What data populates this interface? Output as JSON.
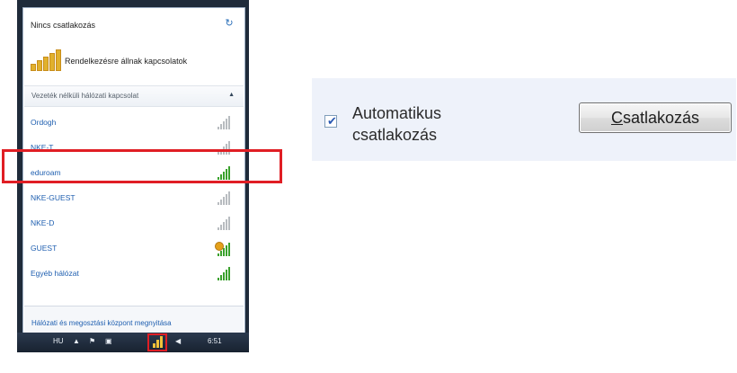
{
  "flyout": {
    "status_title": "Nincs csatlakozás",
    "available_label": "Rendelkezésre állnak kapcsolatok",
    "section_label": "Vezeték nélküli hálózati kapcsolat",
    "networks": [
      {
        "name": "Ordogh",
        "signal": "weak"
      },
      {
        "name": "NKE-T",
        "signal": "weak"
      },
      {
        "name": "eduroam",
        "signal": "strong"
      },
      {
        "name": "NKE-GUEST",
        "signal": "weak"
      },
      {
        "name": "NKE-D",
        "signal": "weak"
      },
      {
        "name": "GUEST",
        "signal": "strong-unsecured"
      },
      {
        "name": "Egyéb hálózat",
        "signal": "strong"
      }
    ],
    "footer_link": "Hálózati és megosztási központ megnyitása"
  },
  "taskbar": {
    "language": "HU",
    "time": "6:51"
  },
  "connect_panel": {
    "auto_connect_label": "Automatikus csatlakozás",
    "auto_connect_checked": true,
    "connect_button": "Csatlakozás"
  },
  "colors": {
    "highlight": "#e01e24",
    "link": "#1f5fb0",
    "signal_on": "#3aa12d"
  }
}
